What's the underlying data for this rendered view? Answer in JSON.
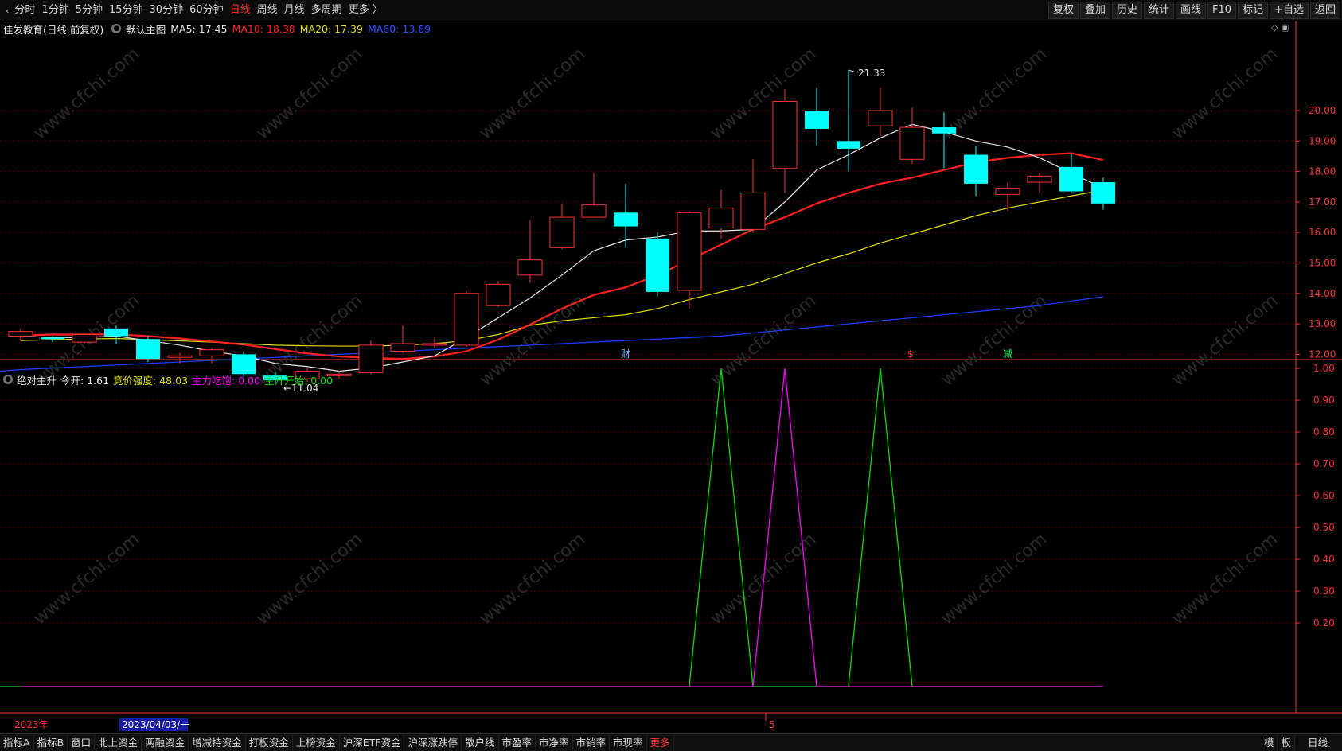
{
  "toolbar": {
    "periods": [
      "分时",
      "1分钟",
      "5分钟",
      "15分钟",
      "30分钟",
      "60分钟",
      "日线",
      "周线",
      "月线",
      "多周期",
      "更多 〉"
    ],
    "active_period": "日线",
    "right_buttons": [
      "复权",
      "叠加",
      "历史",
      "统计",
      "画线",
      "F10",
      "标记",
      "+自选",
      "返回"
    ]
  },
  "stock": {
    "name": "佳发教育",
    "mode": "(日线,前复权)",
    "main_chart": "默认主图",
    "ma5": "MA5: 17.45",
    "ma10": "MA10: 18.38",
    "ma20": "MA20: 17.39",
    "ma60": "MA60: 13.89"
  },
  "indicator": {
    "name": "绝对主升",
    "today_open": "今开: 1.61",
    "bid_strength": "竞价强度: 48.03",
    "main_force": "主力吃饱: 0.00",
    "rise_start": "主升开始: 0.00"
  },
  "colors": {
    "up": "#ff3232",
    "down": "#00ffff",
    "ma5": "#e8e8e8",
    "ma10": "#ff2020",
    "ma20": "#e0e000",
    "ma60": "#1a3cff",
    "grid": "#5a0000",
    "axis": "#ff3232",
    "ind_green": "#00e000",
    "ind_magenta": "#ff00ff"
  },
  "chart_data": {
    "type": "candlestick",
    "price_ticks": [
      "20.00",
      "19.00",
      "18.00",
      "17.00",
      "16.00",
      "15.00",
      "14.00",
      "13.00",
      "12.00"
    ],
    "price_range": [
      11.0,
      21.7
    ],
    "high_label": "21.33",
    "low_label": "11.04",
    "candles": [
      [
        12.6,
        12.75,
        12.85,
        12.45
      ],
      [
        12.55,
        12.5,
        12.6,
        12.4
      ],
      [
        12.4,
        12.65,
        12.7,
        12.35
      ],
      [
        12.85,
        12.6,
        12.95,
        12.35
      ],
      [
        12.5,
        11.85,
        12.6,
        11.75
      ],
      [
        11.9,
        11.95,
        12.05,
        11.7
      ],
      [
        11.95,
        12.15,
        12.2,
        11.7
      ],
      [
        12.0,
        11.35,
        12.1,
        11.25
      ],
      [
        11.3,
        11.15,
        11.4,
        11.04
      ],
      [
        11.2,
        11.45,
        11.55,
        11.1
      ],
      [
        11.3,
        11.35,
        11.45,
        11.2
      ],
      [
        11.4,
        12.3,
        12.45,
        11.35
      ],
      [
        12.1,
        12.35,
        12.95,
        12.05
      ],
      [
        12.3,
        12.35,
        12.55,
        12.2
      ],
      [
        12.3,
        14.0,
        14.1,
        12.25
      ],
      [
        13.6,
        14.3,
        14.4,
        13.55
      ],
      [
        14.6,
        15.1,
        16.4,
        14.35
      ],
      [
        15.5,
        16.5,
        16.95,
        15.45
      ],
      [
        16.5,
        16.9,
        17.95,
        16.5
      ],
      [
        16.65,
        16.2,
        17.6,
        15.5
      ],
      [
        15.8,
        14.05,
        16.0,
        13.9
      ],
      [
        14.1,
        16.65,
        16.7,
        13.5
      ],
      [
        16.15,
        16.8,
        17.4,
        15.8
      ],
      [
        16.1,
        17.3,
        18.4,
        16.0
      ],
      [
        18.1,
        20.3,
        20.7,
        17.3
      ],
      [
        20.0,
        19.4,
        20.75,
        18.85
      ],
      [
        19.0,
        18.75,
        21.33,
        18.0
      ],
      [
        19.5,
        20.0,
        20.75,
        19.15
      ],
      [
        18.4,
        19.45,
        20.1,
        18.25
      ],
      [
        19.45,
        19.25,
        19.95,
        18.1
      ],
      [
        18.55,
        17.6,
        18.85,
        17.2
      ],
      [
        17.25,
        17.45,
        17.65,
        16.7
      ],
      [
        17.65,
        17.85,
        17.95,
        17.3
      ],
      [
        18.15,
        17.35,
        18.6,
        17.3
      ],
      [
        17.65,
        16.95,
        17.8,
        16.75
      ]
    ],
    "ma5": [
      12.6,
      12.55,
      12.55,
      12.6,
      12.45,
      12.3,
      12.1,
      11.95,
      11.7,
      11.6,
      11.45,
      11.55,
      11.75,
      11.95,
      12.55,
      13.2,
      13.85,
      14.6,
      15.4,
      15.75,
      15.85,
      16.05,
      16.05,
      16.1,
      17.0,
      18.05,
      18.55,
      19.1,
      19.55,
      19.3,
      19.0,
      18.8,
      18.45,
      17.95,
      17.45
    ],
    "ma10": [
      12.62,
      12.65,
      12.65,
      12.66,
      12.6,
      12.52,
      12.42,
      12.32,
      12.17,
      12.03,
      11.93,
      11.88,
      11.85,
      11.93,
      12.1,
      12.48,
      12.98,
      13.5,
      13.95,
      14.2,
      14.6,
      15.1,
      15.6,
      16.1,
      16.5,
      16.95,
      17.3,
      17.6,
      17.8,
      18.05,
      18.3,
      18.45,
      18.55,
      18.6,
      18.38
    ],
    "ma20": [
      12.45,
      12.48,
      12.5,
      12.52,
      12.48,
      12.44,
      12.4,
      12.35,
      12.3,
      12.28,
      12.27,
      12.27,
      12.3,
      12.35,
      12.45,
      12.65,
      12.95,
      13.1,
      13.2,
      13.3,
      13.5,
      13.8,
      14.05,
      14.3,
      14.65,
      15.0,
      15.3,
      15.65,
      15.95,
      16.25,
      16.55,
      16.8,
      17.0,
      17.2,
      17.39
    ],
    "ma60": [
      11.5,
      11.55,
      11.6,
      11.65,
      11.7,
      11.75,
      11.8,
      11.85,
      11.9,
      11.95,
      12.0,
      12.05,
      12.1,
      12.15,
      12.2,
      12.25,
      12.3,
      12.35,
      12.4,
      12.45,
      12.5,
      12.55,
      12.6,
      12.7,
      12.8,
      12.9,
      13.0,
      13.1,
      13.2,
      13.3,
      13.4,
      13.5,
      13.6,
      13.75,
      13.89
    ],
    "markers": [
      {
        "index": 19,
        "text": "财",
        "color": "#5fb3ff"
      },
      {
        "index": 28,
        "text": "$",
        "color": "#ff3232"
      },
      {
        "index": 31,
        "text": "减",
        "color": "#00ff66"
      }
    ],
    "indicator_ticks": [
      "1.00",
      "0.90",
      "0.80",
      "0.70",
      "0.60",
      "0.50",
      "0.40",
      "0.30",
      "0.20"
    ],
    "indicator_series": [
      {
        "color": "#00e000",
        "values": [
          0,
          0,
          0,
          0,
          0,
          0,
          0,
          0,
          0,
          0,
          0,
          0,
          0,
          0,
          0,
          0,
          0,
          0,
          0,
          0,
          0,
          0,
          1,
          0,
          0,
          0,
          0,
          1,
          0,
          0,
          0,
          0,
          0,
          0,
          0
        ]
      },
      {
        "color": "#ff00ff",
        "values": [
          0,
          0,
          0,
          0,
          0,
          0,
          0,
          0,
          0,
          0,
          0,
          0,
          0,
          0,
          0,
          0,
          0,
          0,
          0,
          0,
          0,
          0,
          0,
          0,
          1,
          0,
          0,
          0,
          0,
          0,
          0,
          0,
          0,
          0,
          0
        ]
      }
    ],
    "x_labels": {
      "start": "2023年",
      "cursor": "2023/04/03/一",
      "mid": "5"
    }
  },
  "watermark": "www.cfchi.com",
  "bottom": {
    "tabs": [
      "指标A",
      "指标B",
      "窗口",
      "北上资金",
      "两融资金",
      "增减持资金",
      "打板资金",
      "上榜资金",
      "沪深ETF资金",
      "沪深涨跌停",
      "散户线",
      "市盈率",
      "市净率",
      "市销率",
      "市现率",
      "更多"
    ],
    "right": [
      "模",
      "板",
      "日线"
    ]
  }
}
